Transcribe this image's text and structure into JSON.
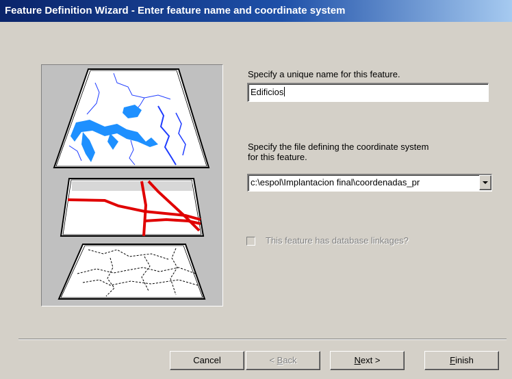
{
  "window": {
    "title": "Feature Definition Wizard - Enter feature name and coordinate system"
  },
  "name_section": {
    "label": "Specify a unique name for this feature.",
    "value": "Edificios"
  },
  "coord_section": {
    "label_line1": "Specify the file defining the coordinate system",
    "label_line2": "for this feature.",
    "value": "c:\\espol\\Implantacion final\\coordenadas_pr"
  },
  "linkage_checkbox": {
    "label": "This feature has database linkages?",
    "checked": false,
    "enabled": false
  },
  "buttons": {
    "cancel": "Cancel",
    "back_mnemonic": "B",
    "back_rest": "ack",
    "back_prefix": "< ",
    "next_mnemonic": "N",
    "next_rest": "ext >",
    "finish_mnemonic": "F",
    "finish_rest": "inish"
  },
  "colors": {
    "face": "#d4d0c8",
    "title_start": "#0a246a",
    "title_end": "#a6caf0",
    "water": "#1e90ff",
    "roads": "#e00000"
  },
  "icons": [
    "map-layers-illustration",
    "combo-dropdown-arrow-icon"
  ]
}
